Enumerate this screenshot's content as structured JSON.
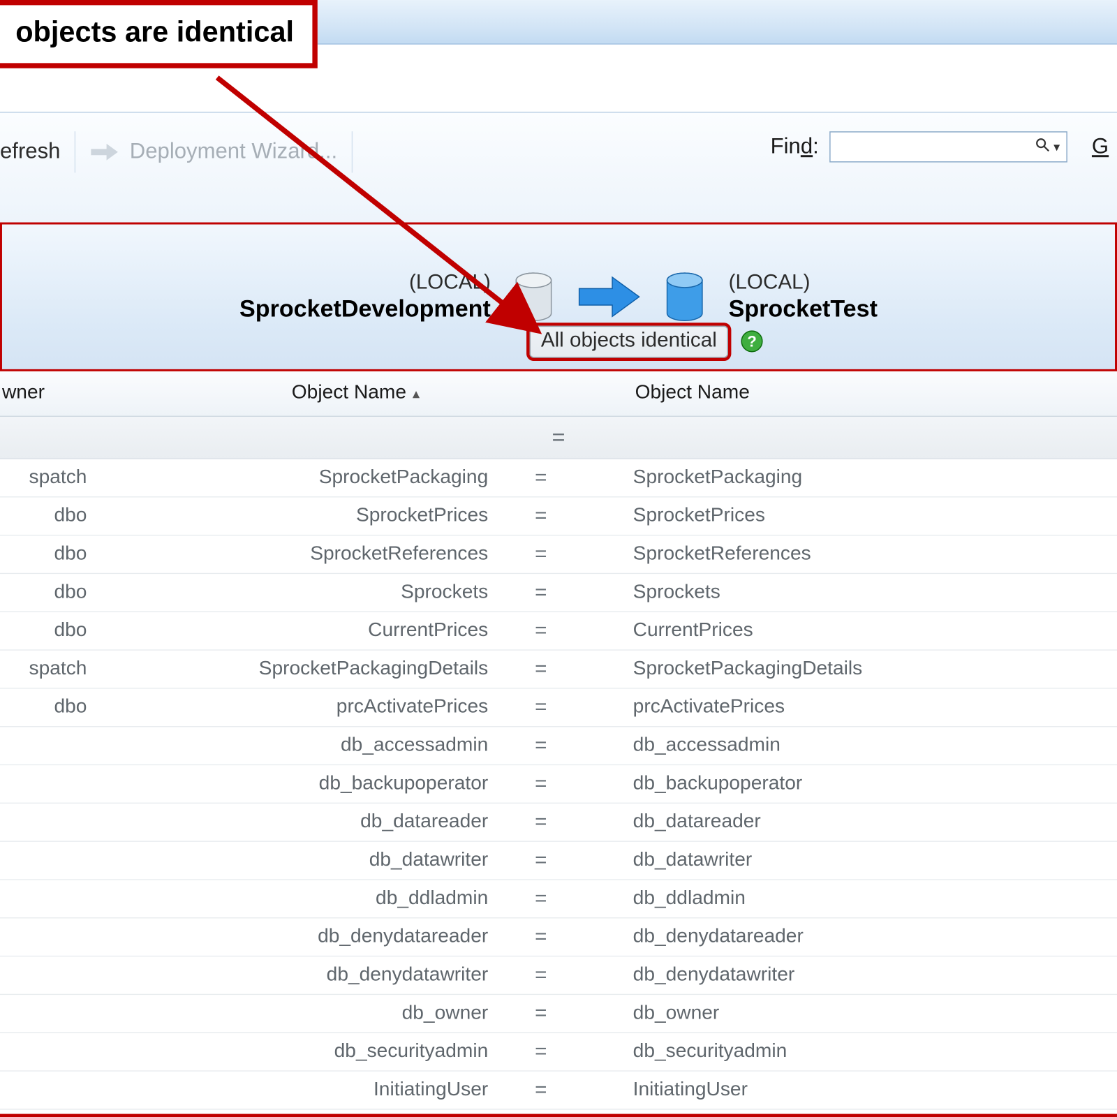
{
  "callout": {
    "text": "objects are identical"
  },
  "toolbar": {
    "refresh_label": "efresh",
    "deployment_label": "Deployment Wizard...",
    "find_label_html": "Find:",
    "g_label": "G"
  },
  "band": {
    "source": {
      "local": "(LOCAL)",
      "name": "SprocketDevelopment"
    },
    "target": {
      "local": "(LOCAL)",
      "name": "SprocketTest"
    },
    "status": "All objects identical"
  },
  "grid": {
    "col_owner": "wner",
    "col_obj1": "Object Name",
    "col_obj2": "Object Name",
    "equals": "="
  },
  "rows": [
    {
      "owner": "spatch",
      "l": "SprocketPackaging",
      "r": "SprocketPackaging"
    },
    {
      "owner": "dbo",
      "l": "SprocketPrices",
      "r": "SprocketPrices"
    },
    {
      "owner": "dbo",
      "l": "SprocketReferences",
      "r": "SprocketReferences"
    },
    {
      "owner": "dbo",
      "l": "Sprockets",
      "r": "Sprockets"
    },
    {
      "owner": "dbo",
      "l": "CurrentPrices",
      "r": "CurrentPrices"
    },
    {
      "owner": "spatch",
      "l": "SprocketPackagingDetails",
      "r": "SprocketPackagingDetails"
    },
    {
      "owner": "dbo",
      "l": "prcActivatePrices",
      "r": "prcActivatePrices"
    },
    {
      "owner": "",
      "l": "db_accessadmin",
      "r": "db_accessadmin"
    },
    {
      "owner": "",
      "l": "db_backupoperator",
      "r": "db_backupoperator"
    },
    {
      "owner": "",
      "l": "db_datareader",
      "r": "db_datareader"
    },
    {
      "owner": "",
      "l": "db_datawriter",
      "r": "db_datawriter"
    },
    {
      "owner": "",
      "l": "db_ddladmin",
      "r": "db_ddladmin"
    },
    {
      "owner": "",
      "l": "db_denydatareader",
      "r": "db_denydatareader"
    },
    {
      "owner": "",
      "l": "db_denydatawriter",
      "r": "db_denydatawriter"
    },
    {
      "owner": "",
      "l": "db_owner",
      "r": "db_owner"
    },
    {
      "owner": "",
      "l": "db_securityadmin",
      "r": "db_securityadmin"
    },
    {
      "owner": "",
      "l": "InitiatingUser",
      "r": "InitiatingUser"
    }
  ]
}
